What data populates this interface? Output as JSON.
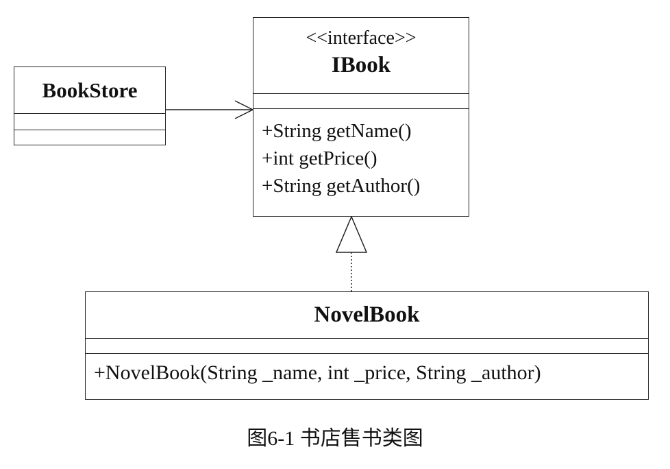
{
  "classes": {
    "bookstore": {
      "name": "BookStore"
    },
    "ibook": {
      "stereotype": "<<interface>>",
      "name": "IBook",
      "operations": [
        "+String getName()",
        "+int getPrice()",
        "+String getAuthor()"
      ]
    },
    "novelbook": {
      "name": "NovelBook",
      "operations": [
        "+NovelBook(String _name, int _price, String _author)"
      ]
    }
  },
  "relations": [
    {
      "from": "BookStore",
      "to": "IBook",
      "kind": "association"
    },
    {
      "from": "NovelBook",
      "to": "IBook",
      "kind": "realization"
    }
  ],
  "caption": "图6-1 书店售书类图"
}
